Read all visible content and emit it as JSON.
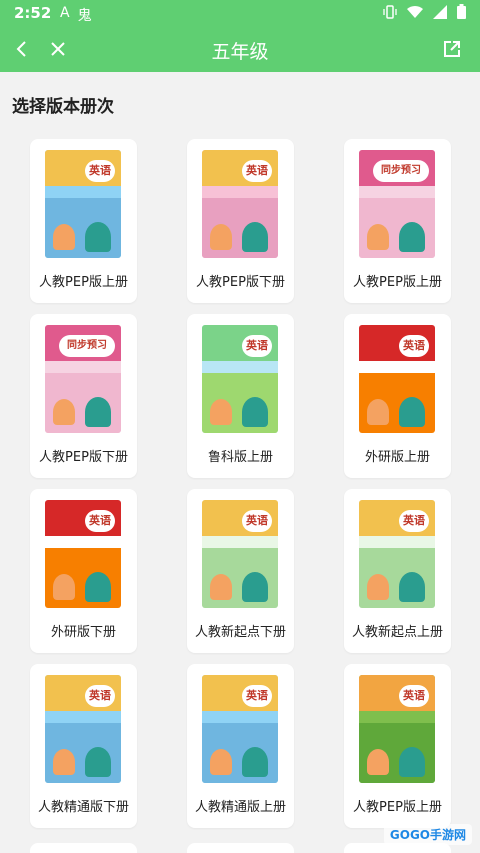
{
  "status_bar": {
    "time": "2:52",
    "left_icons": [
      "A",
      "鬼"
    ],
    "right_icons": [
      "vibrate-icon",
      "wifi-icon",
      "signal-icon",
      "battery-icon"
    ]
  },
  "app_bar": {
    "title": "五年级"
  },
  "section_title": "选择版本册次",
  "books": [
    {
      "label": "人教PEP版上册",
      "subject": "英语",
      "theme": "blue"
    },
    {
      "label": "人教PEP版下册",
      "subject": "英语",
      "theme": "pink"
    },
    {
      "label": "人教PEP版上册",
      "subject": "同步预习",
      "theme": "sync"
    },
    {
      "label": "人教PEP版下册",
      "subject": "同步预习",
      "theme": "sync"
    },
    {
      "label": "鲁科版上册",
      "subject": "英语",
      "theme": "lu"
    },
    {
      "label": "外研版上册",
      "subject": "英语",
      "theme": "red"
    },
    {
      "label": "外研版下册",
      "subject": "英语",
      "theme": "red"
    },
    {
      "label": "人教新起点下册",
      "subject": "英语",
      "theme": "green"
    },
    {
      "label": "人教新起点上册",
      "subject": "英语",
      "theme": "green"
    },
    {
      "label": "人教精通版下册",
      "subject": "英语",
      "theme": "blue"
    },
    {
      "label": "人教精通版上册",
      "subject": "英语",
      "theme": "blue"
    },
    {
      "label": "人教PEP版上册",
      "subject": "英语",
      "theme": "green2"
    }
  ],
  "watermark": "GOGO手游网",
  "colors": {
    "accent": "#5fcf72",
    "background": "#f2f2f2"
  }
}
